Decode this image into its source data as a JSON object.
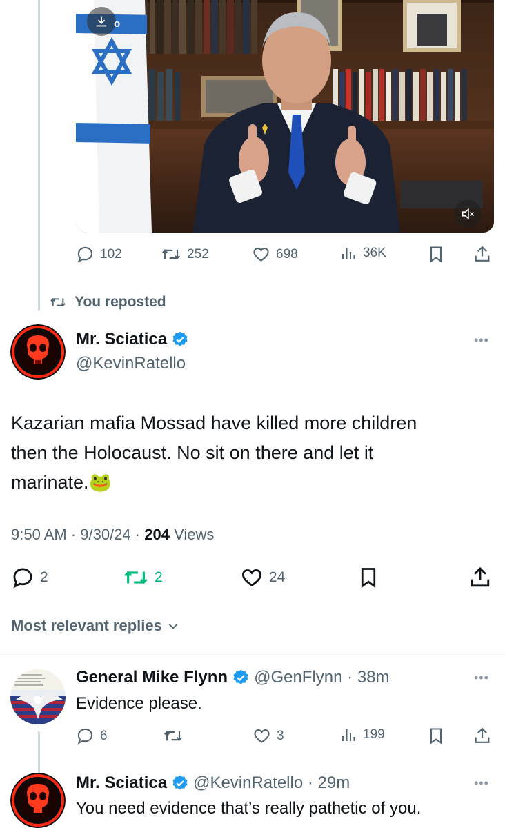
{
  "media": {
    "download_suffix": "o",
    "actions": {
      "replies": "102",
      "reposts": "252",
      "likes": "698",
      "views": "36K"
    }
  },
  "repost_note": "You reposted",
  "main_tweet": {
    "name": "Mr. Sciatica",
    "handle": "@KevinRatello",
    "text_line1": "Kazarian mafia Mossad have killed more children",
    "text_line2": "then the Holocaust. No sit on there and let it",
    "text_line3": "marinate.🐸",
    "time": "9:50 AM · 9/30/24 · ",
    "views_count": "204",
    "views_label": " Views",
    "actions": {
      "replies": "2",
      "reposts": "2",
      "likes": "24"
    },
    "more": "•••"
  },
  "replies_filter": "Most relevant replies",
  "reply1": {
    "name": "General Mike Flynn",
    "handle": "@GenFlynn · 38m",
    "text": "Evidence please.",
    "actions": {
      "replies": "6",
      "likes": "3",
      "views": "199"
    },
    "more": "•••"
  },
  "reply2": {
    "name": "Mr. Sciatica",
    "handle": "@KevinRatello · 29m",
    "text": "You need evidence that’s really pathetic of you.",
    "more": "•••"
  },
  "colors": {
    "text": "#0f1419",
    "muted": "#536471",
    "repost_active": "#00ba7c",
    "verified": "#1d9bf0"
  }
}
